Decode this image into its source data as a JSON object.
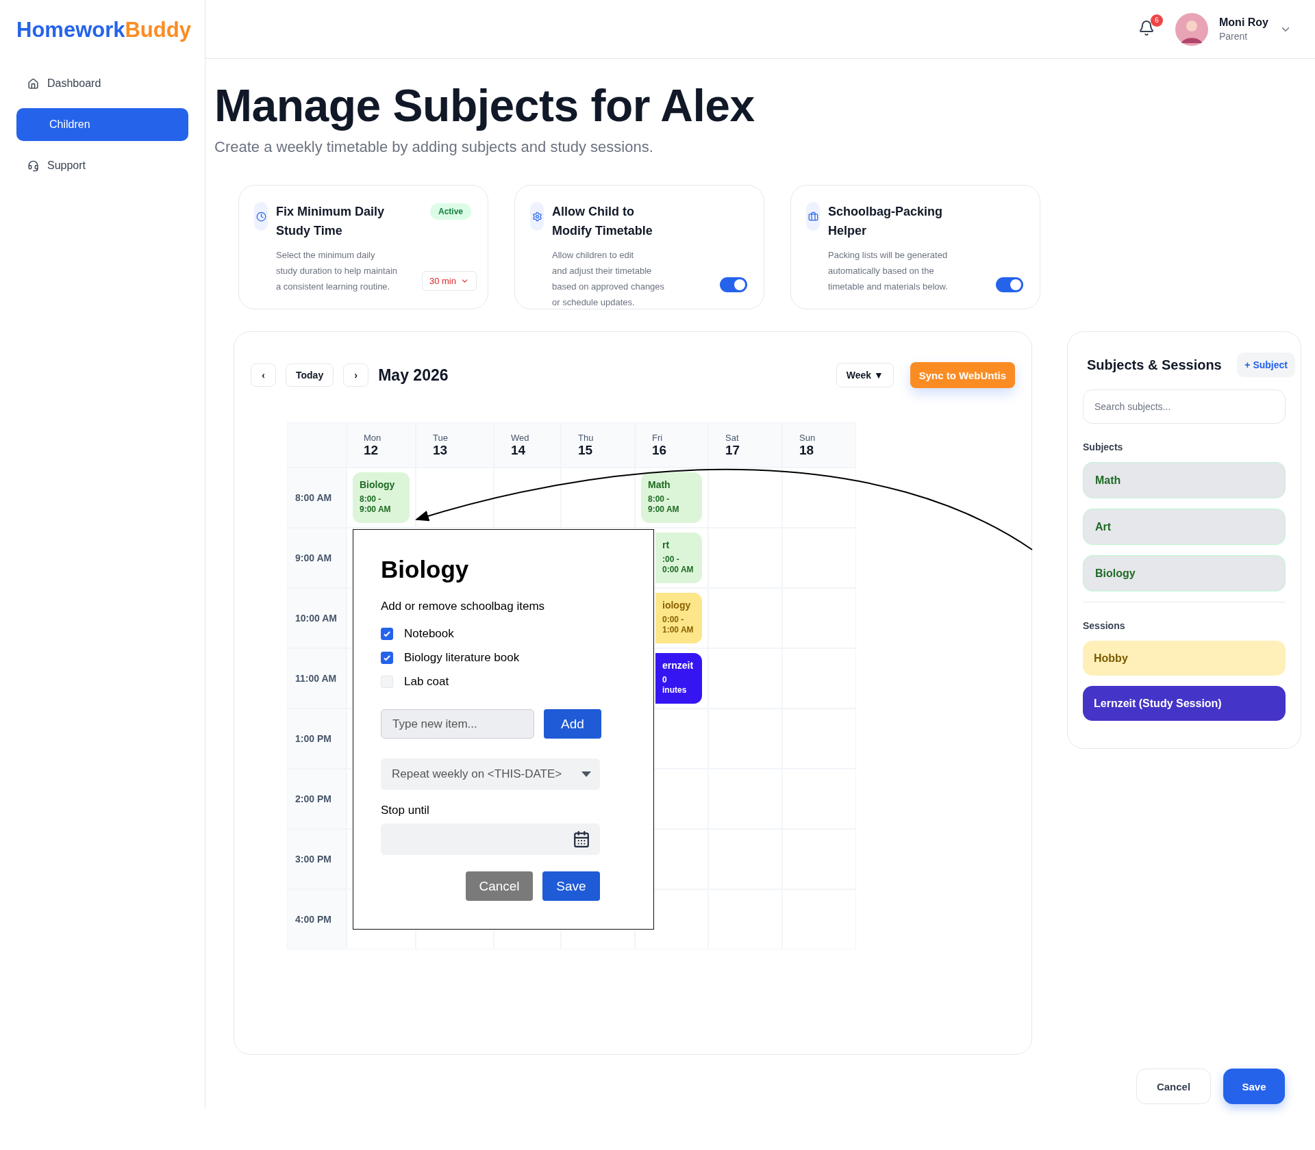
{
  "brand": {
    "first": "Homework",
    "second": "Buddy"
  },
  "sidebar": {
    "items": [
      {
        "label": "Dashboard",
        "selected": false
      },
      {
        "label": "Children",
        "selected": true
      },
      {
        "label": "Support",
        "selected": false
      }
    ]
  },
  "header": {
    "notifications": "6",
    "user_name": "Moni Roy",
    "user_role": "Parent"
  },
  "page": {
    "title": "Manage Subjects for Alex",
    "subtitle": "Create a weekly timetable by adding subjects and study sessions."
  },
  "settings": [
    {
      "kind": "select",
      "title": "Fix Minimum Daily Study Time",
      "badge": "Active",
      "description": "Select the minimum daily\n study duration to help maintain\n a consistent learning routine.",
      "value": "30 min"
    },
    {
      "kind": "toggle",
      "title": "Allow Child to Modify Timetable",
      "description": "Allow children to edit\n and adjust their timetable\n based on approved changes\n or schedule updates.",
      "on": true
    },
    {
      "kind": "toggle",
      "title": "Schoolbag-Packing Helper",
      "description": "Packing lists will be generated\nautomatically based on the\ntimetable and materials below.",
      "on": true
    }
  ],
  "calendar": {
    "prev": "‹",
    "today": "Today",
    "next": "›",
    "month": "May 2026",
    "view": "Week ▼",
    "sync": "Sync to WebUntis",
    "days": [
      {
        "name": "Mon",
        "date": "12"
      },
      {
        "name": "Tue",
        "date": "13"
      },
      {
        "name": "Wed",
        "date": "14"
      },
      {
        "name": "Thu",
        "date": "15"
      },
      {
        "name": "Fri",
        "date": "16"
      },
      {
        "name": "Sat",
        "date": "17"
      },
      {
        "name": "Sun",
        "date": "18"
      }
    ],
    "rows": [
      {
        "time": "8:00 AM",
        "cells": [
          {
            "kind": "subject",
            "clipped": false,
            "title": "Biology",
            "lines": [
              "8:00 -",
              "9:00 AM"
            ]
          },
          {
            "kind": "empty"
          },
          {
            "kind": "empty"
          },
          {
            "kind": "empty"
          },
          {
            "kind": "subject",
            "clipped": false,
            "title": "Math",
            "lines": [
              "8:00 -",
              "9:00 AM"
            ]
          },
          {
            "kind": "empty"
          },
          {
            "kind": "empty"
          }
        ]
      },
      {
        "time": "9:00 AM",
        "cells": [
          {
            "kind": "empty"
          },
          {
            "kind": "empty"
          },
          {
            "kind": "empty"
          },
          {
            "kind": "empty"
          },
          {
            "kind": "subject",
            "clipped": true,
            "title": "rt",
            "lines": [
              ":00 -",
              "0:00 AM"
            ]
          },
          {
            "kind": "empty"
          },
          {
            "kind": "empty"
          }
        ]
      },
      {
        "time": "10:00 AM",
        "cells": [
          {
            "kind": "empty"
          },
          {
            "kind": "covered"
          },
          {
            "kind": "covered"
          },
          {
            "kind": "covered"
          },
          {
            "kind": "hobby",
            "clipped": true,
            "title": "iology",
            "lines": [
              "0:00 -",
              "1:00 AM"
            ]
          },
          {
            "kind": "empty"
          },
          {
            "kind": "empty"
          }
        ]
      },
      {
        "time": "11:00 AM",
        "cells": [
          {
            "kind": "empty"
          },
          {
            "kind": "covered"
          },
          {
            "kind": "empty"
          },
          {
            "kind": "empty"
          },
          {
            "kind": "study",
            "clipped": true,
            "title": "ernzeit",
            "lines": [
              "0",
              "inutes"
            ]
          },
          {
            "kind": "empty"
          },
          {
            "kind": "empty"
          }
        ]
      },
      {
        "time": "1:00 PM",
        "cells": [
          {
            "kind": "empty"
          },
          {
            "kind": "empty"
          },
          {
            "kind": "empty"
          },
          {
            "kind": "empty"
          },
          {
            "kind": "empty"
          },
          {
            "kind": "empty"
          },
          {
            "kind": "empty"
          }
        ]
      },
      {
        "time": "2:00 PM",
        "cells": [
          {
            "kind": "empty"
          },
          {
            "kind": "empty"
          },
          {
            "kind": "empty"
          },
          {
            "kind": "empty"
          },
          {
            "kind": "empty"
          },
          {
            "kind": "empty"
          },
          {
            "kind": "empty"
          }
        ]
      },
      {
        "time": "3:00 PM",
        "cells": [
          {
            "kind": "empty"
          },
          {
            "kind": "empty"
          },
          {
            "kind": "empty"
          },
          {
            "kind": "empty"
          },
          {
            "kind": "empty"
          },
          {
            "kind": "empty"
          },
          {
            "kind": "empty"
          }
        ]
      },
      {
        "time": "4:00 PM",
        "cells": [
          {
            "kind": "empty"
          },
          {
            "kind": "empty"
          },
          {
            "kind": "empty"
          },
          {
            "kind": "empty"
          },
          {
            "kind": "empty"
          },
          {
            "kind": "empty"
          },
          {
            "kind": "empty"
          }
        ]
      }
    ]
  },
  "popup": {
    "title": "Biology",
    "subtitle": "Add or remove schoolbag items",
    "items": [
      {
        "label": "Notebook",
        "checked": true
      },
      {
        "label": "Biology literature book",
        "checked": true
      },
      {
        "label": "Lab coat",
        "checked": false
      }
    ],
    "new_item_placeholder": "Type new item...",
    "add": "Add",
    "repeat": "Repeat weekly on <THIS-DATE>",
    "stop_label": "Stop until",
    "cancel": "Cancel",
    "save": "Save"
  },
  "panel": {
    "title": "Subjects & Sessions",
    "add": "+ Subject",
    "search_placeholder": "Search subjects...",
    "subjects_label": "Subjects",
    "subjects": [
      {
        "label": "Math"
      },
      {
        "label": "Art"
      },
      {
        "label": "Biology"
      }
    ],
    "sessions_label": "Sessions",
    "sessions": [
      {
        "label": "Hobby",
        "kind": "hobby"
      },
      {
        "label": "Lernzeit (Study Session)",
        "kind": "study"
      }
    ]
  },
  "footer": {
    "cancel": "Cancel",
    "save": "Save"
  }
}
